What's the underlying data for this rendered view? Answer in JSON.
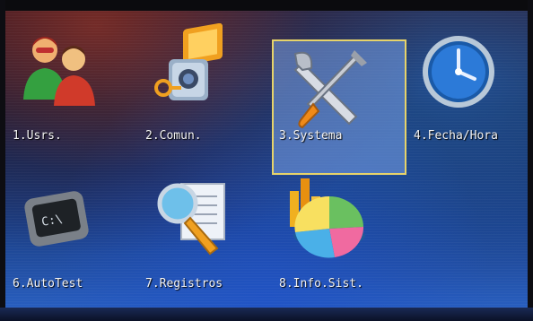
{
  "menu": {
    "items": [
      {
        "label": "1.Usrs.",
        "icon": "users-icon",
        "selected": false
      },
      {
        "label": "2.Comun.",
        "icon": "camera-key-icon",
        "selected": false
      },
      {
        "label": "3.Systema",
        "icon": "tools-icon",
        "selected": true
      },
      {
        "label": "4.Fecha/Hora",
        "icon": "clock-icon",
        "selected": false
      },
      {
        "label": "6.AutoTest",
        "icon": "terminal-icon",
        "selected": false
      },
      {
        "label": "7.Registros",
        "icon": "magnifier-document-icon",
        "selected": false
      },
      {
        "label": "8.Info.Sist.",
        "icon": "pie-chart-icon",
        "selected": false
      }
    ]
  },
  "colors": {
    "selection_fill": "#7aa0e6",
    "selection_border": "#e6d36a",
    "label_text": "#f2f2f2"
  }
}
